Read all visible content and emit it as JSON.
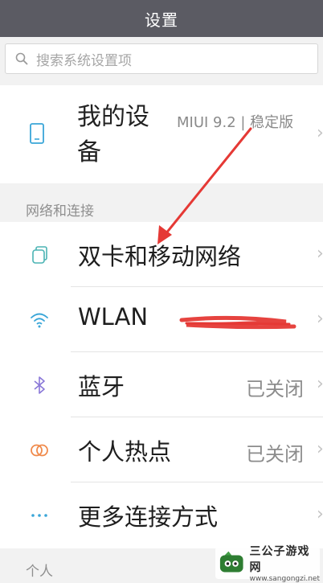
{
  "title": "设置",
  "search": {
    "placeholder": "搜索系统设置项",
    "icon": "search-icon"
  },
  "device": {
    "title": "我的设备",
    "subtitle": "MIUI 9.2 | 稳定版",
    "icon": "phone-icon"
  },
  "sections": {
    "network": "网络和连接",
    "personal": "个人"
  },
  "network_items": [
    {
      "label": "双卡和移动网络",
      "value": "",
      "icon": "sim-icon",
      "icon_color": "#4bb4b4"
    },
    {
      "label": "WLAN",
      "value": "",
      "icon": "wifi-icon",
      "icon_color": "#3aa6d8"
    },
    {
      "label": "蓝牙",
      "value": "已关闭",
      "icon": "bluetooth-icon",
      "icon_color": "#8a78d8"
    },
    {
      "label": "个人热点",
      "value": "已关闭",
      "icon": "hotspot-icon",
      "icon_color": "#f08a4b"
    },
    {
      "label": "更多连接方式",
      "value": "",
      "icon": "more-dots-icon",
      "icon_color": "#3aa6d8"
    }
  ],
  "watermark": {
    "title": "三公子游戏网",
    "url": "www.sangongzi.net"
  },
  "colors": {
    "titlebar": "#5b5b63",
    "annotation": "#e53935"
  }
}
